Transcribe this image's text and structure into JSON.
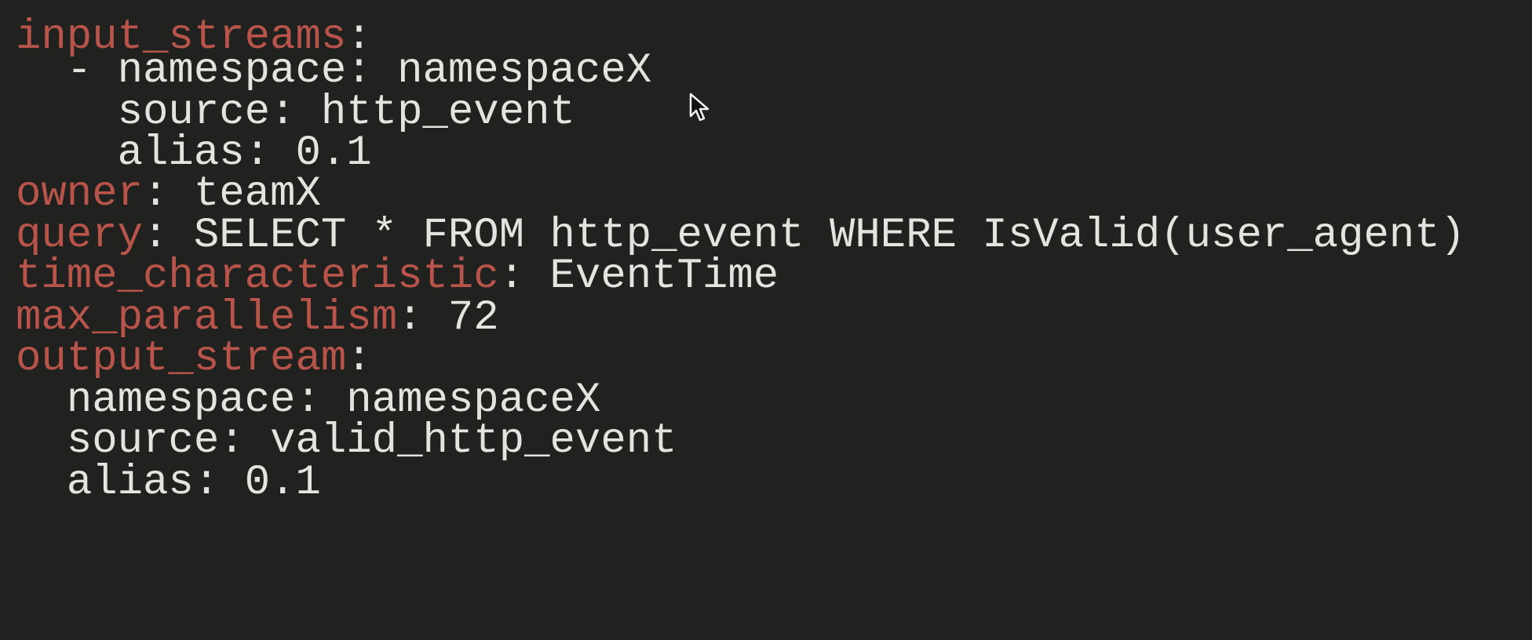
{
  "editor": {
    "lines": [
      {
        "indent": "",
        "key": "input_streams",
        "sep": ":",
        "value": ""
      },
      {
        "indent": "  - ",
        "key": "namespace",
        "sep": ": ",
        "value": "namespaceX"
      },
      {
        "indent": "    ",
        "key": "source",
        "sep": ": ",
        "value": "http_event"
      },
      {
        "indent": "    ",
        "key": "alias",
        "sep": ": ",
        "value": "0.1"
      },
      {
        "indent": "",
        "key": "owner",
        "sep": ": ",
        "value": "teamX"
      },
      {
        "indent": "",
        "key": "query",
        "sep": ": ",
        "value": "SELECT * FROM http_event WHERE IsValid(user_agent)"
      },
      {
        "indent": "",
        "key": "time_characteristic",
        "sep": ": ",
        "value": "EventTime"
      },
      {
        "indent": "",
        "key": "max_parallelism",
        "sep": ": ",
        "value": "72"
      },
      {
        "indent": "",
        "key": "output_stream",
        "sep": ":",
        "value": ""
      },
      {
        "indent": "  ",
        "key": "namespace",
        "sep": ": ",
        "value": "namespaceX"
      },
      {
        "indent": "  ",
        "key": "source",
        "sep": ": ",
        "value": "valid_http_event"
      },
      {
        "indent": "  ",
        "key": "alias",
        "sep": ": ",
        "value": "0.1"
      }
    ]
  },
  "colors": {
    "background": "#212220",
    "top_level_key": "#b8544a",
    "text": "#e4e4df"
  },
  "cursor": {
    "icon": "mouse-pointer-icon"
  }
}
